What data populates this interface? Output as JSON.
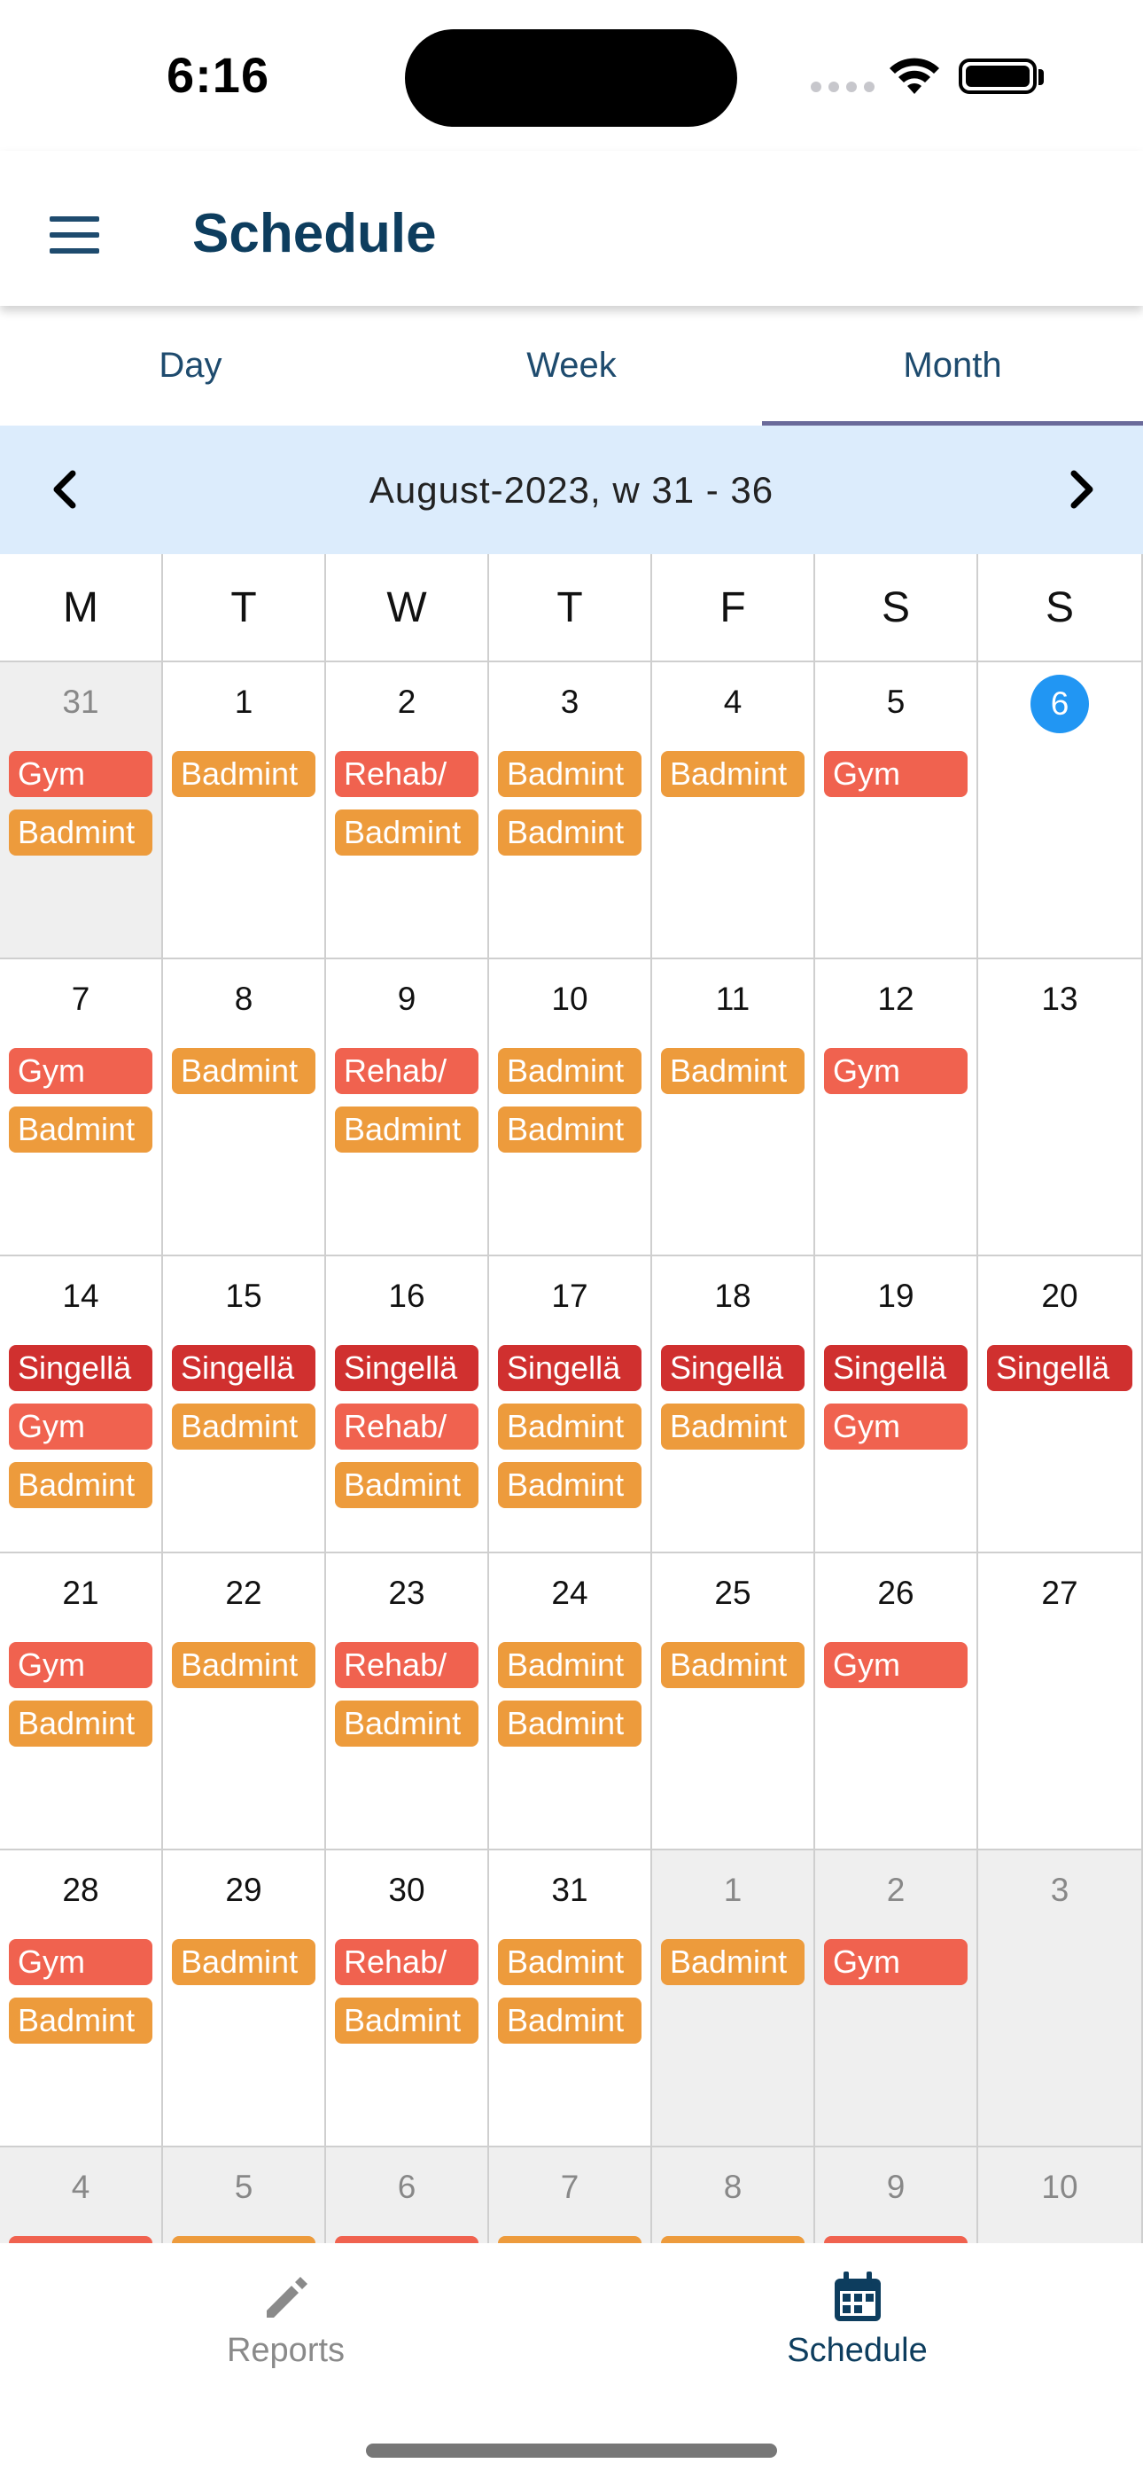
{
  "status_bar": {
    "time": "6:16"
  },
  "app_bar": {
    "title": "Schedule"
  },
  "tabs": [
    {
      "label": "Day"
    },
    {
      "label": "Week"
    },
    {
      "label": "Month"
    }
  ],
  "selected_tab": "Month",
  "month_nav": {
    "label": "August-2023, w 31 - 36"
  },
  "weekdays": [
    "M",
    "T",
    "W",
    "T",
    "F",
    "S",
    "S"
  ],
  "colors": {
    "accent": "#0d3d5e",
    "today": "#2196f3",
    "gym": "#f0624f",
    "badmint": "#ed9b3c",
    "rehab": "#f0624f",
    "singella": "#d0302f",
    "nav_bg": "#dcecfc"
  },
  "weeks": [
    [
      {
        "day": "31",
        "other": true,
        "events": [
          {
            "t": "Gym",
            "k": "gym"
          },
          {
            "t": "Badmint",
            "k": "badmint"
          }
        ]
      },
      {
        "day": "1",
        "events": [
          {
            "t": "Badmint",
            "k": "badmint"
          }
        ]
      },
      {
        "day": "2",
        "events": [
          {
            "t": "Rehab/",
            "k": "rehab"
          },
          {
            "t": "Badmint",
            "k": "badmint"
          }
        ]
      },
      {
        "day": "3",
        "events": [
          {
            "t": "Badmint",
            "k": "badmint"
          },
          {
            "t": "Badmint",
            "k": "badmint"
          }
        ]
      },
      {
        "day": "4",
        "events": [
          {
            "t": "Badmint",
            "k": "badmint"
          }
        ]
      },
      {
        "day": "5",
        "events": [
          {
            "t": "Gym",
            "k": "gym"
          }
        ]
      },
      {
        "day": "6",
        "today": true,
        "events": []
      }
    ],
    [
      {
        "day": "7",
        "events": [
          {
            "t": "Gym",
            "k": "gym"
          },
          {
            "t": "Badmint",
            "k": "badmint"
          }
        ]
      },
      {
        "day": "8",
        "events": [
          {
            "t": "Badmint",
            "k": "badmint"
          }
        ]
      },
      {
        "day": "9",
        "events": [
          {
            "t": "Rehab/",
            "k": "rehab"
          },
          {
            "t": "Badmint",
            "k": "badmint"
          }
        ]
      },
      {
        "day": "10",
        "events": [
          {
            "t": "Badmint",
            "k": "badmint"
          },
          {
            "t": "Badmint",
            "k": "badmint"
          }
        ]
      },
      {
        "day": "11",
        "events": [
          {
            "t": "Badmint",
            "k": "badmint"
          }
        ]
      },
      {
        "day": "12",
        "events": [
          {
            "t": "Gym",
            "k": "gym"
          }
        ]
      },
      {
        "day": "13",
        "events": []
      }
    ],
    [
      {
        "day": "14",
        "events": [
          {
            "t": "Singellä",
            "k": "singella"
          },
          {
            "t": "Gym",
            "k": "gym"
          },
          {
            "t": "Badmint",
            "k": "badmint"
          }
        ]
      },
      {
        "day": "15",
        "events": [
          {
            "t": "Singellä",
            "k": "singella"
          },
          {
            "t": "Badmint",
            "k": "badmint"
          }
        ]
      },
      {
        "day": "16",
        "events": [
          {
            "t": "Singellä",
            "k": "singella"
          },
          {
            "t": "Rehab/",
            "k": "rehab"
          },
          {
            "t": "Badmint",
            "k": "badmint"
          }
        ]
      },
      {
        "day": "17",
        "events": [
          {
            "t": "Singellä",
            "k": "singella"
          },
          {
            "t": "Badmint",
            "k": "badmint"
          },
          {
            "t": "Badmint",
            "k": "badmint"
          }
        ]
      },
      {
        "day": "18",
        "events": [
          {
            "t": "Singellä",
            "k": "singella"
          },
          {
            "t": "Badmint",
            "k": "badmint"
          }
        ]
      },
      {
        "day": "19",
        "events": [
          {
            "t": "Singellä",
            "k": "singella"
          },
          {
            "t": "Gym",
            "k": "gym"
          }
        ]
      },
      {
        "day": "20",
        "events": [
          {
            "t": "Singellä",
            "k": "singella"
          }
        ]
      }
    ],
    [
      {
        "day": "21",
        "events": [
          {
            "t": "Gym",
            "k": "gym"
          },
          {
            "t": "Badmint",
            "k": "badmint"
          }
        ]
      },
      {
        "day": "22",
        "events": [
          {
            "t": "Badmint",
            "k": "badmint"
          }
        ]
      },
      {
        "day": "23",
        "events": [
          {
            "t": "Rehab/",
            "k": "rehab"
          },
          {
            "t": "Badmint",
            "k": "badmint"
          }
        ]
      },
      {
        "day": "24",
        "events": [
          {
            "t": "Badmint",
            "k": "badmint"
          },
          {
            "t": "Badmint",
            "k": "badmint"
          }
        ]
      },
      {
        "day": "25",
        "events": [
          {
            "t": "Badmint",
            "k": "badmint"
          }
        ]
      },
      {
        "day": "26",
        "events": [
          {
            "t": "Gym",
            "k": "gym"
          }
        ]
      },
      {
        "day": "27",
        "events": []
      }
    ],
    [
      {
        "day": "28",
        "events": [
          {
            "t": "Gym",
            "k": "gym"
          },
          {
            "t": "Badmint",
            "k": "badmint"
          }
        ]
      },
      {
        "day": "29",
        "events": [
          {
            "t": "Badmint",
            "k": "badmint"
          }
        ]
      },
      {
        "day": "30",
        "events": [
          {
            "t": "Rehab/",
            "k": "rehab"
          },
          {
            "t": "Badmint",
            "k": "badmint"
          }
        ]
      },
      {
        "day": "31",
        "events": [
          {
            "t": "Badmint",
            "k": "badmint"
          },
          {
            "t": "Badmint",
            "k": "badmint"
          }
        ]
      },
      {
        "day": "1",
        "other": true,
        "events": [
          {
            "t": "Badmint",
            "k": "badmint"
          }
        ]
      },
      {
        "day": "2",
        "other": true,
        "events": [
          {
            "t": "Gym",
            "k": "gym"
          }
        ]
      },
      {
        "day": "3",
        "other": true,
        "events": []
      }
    ],
    [
      {
        "day": "4",
        "other": true,
        "events": [
          {
            "t": "",
            "k": "gym"
          }
        ]
      },
      {
        "day": "5",
        "other": true,
        "events": [
          {
            "t": "",
            "k": "badmint"
          }
        ]
      },
      {
        "day": "6",
        "other": true,
        "events": [
          {
            "t": "",
            "k": "rehab"
          }
        ]
      },
      {
        "day": "7",
        "other": true,
        "events": [
          {
            "t": "",
            "k": "badmint"
          }
        ]
      },
      {
        "day": "8",
        "other": true,
        "events": [
          {
            "t": "",
            "k": "badmint"
          }
        ]
      },
      {
        "day": "9",
        "other": true,
        "events": [
          {
            "t": "",
            "k": "gym"
          }
        ]
      },
      {
        "day": "10",
        "other": true,
        "events": []
      }
    ]
  ],
  "bottom_nav": [
    {
      "label": "Reports",
      "icon": "pencil-icon",
      "active": false
    },
    {
      "label": "Schedule",
      "icon": "calendar-icon",
      "active": true
    }
  ]
}
